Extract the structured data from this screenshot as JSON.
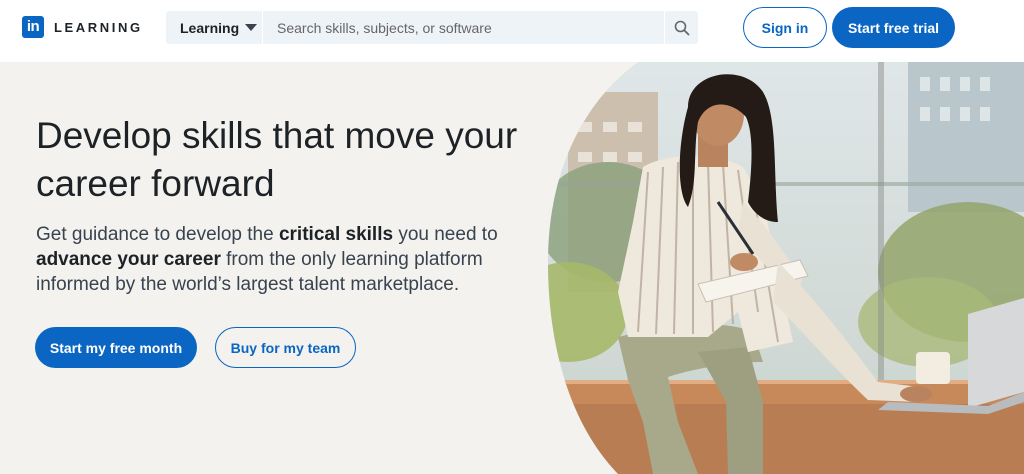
{
  "header": {
    "logo_mark": "in",
    "logo_word": "LEARNING",
    "search": {
      "category_label": "Learning",
      "placeholder": "Search skills, subjects, or software",
      "icon": "search-icon"
    },
    "signin_label": "Sign in",
    "trial_label": "Start free trial"
  },
  "hero": {
    "title": "Develop skills that move your career forward",
    "sub_part1": "Get guidance to develop the ",
    "sub_bold1": "critical skills",
    "sub_part2": " you need to ",
    "sub_bold2": "advance your career",
    "sub_part3": " from the only learning platform informed by the world’s largest talent marketplace.",
    "primary_cta": "Start my free month",
    "secondary_cta": "Buy for my team"
  },
  "colors": {
    "brand_blue": "#0a66c2",
    "hero_bg": "#f3f2ef",
    "search_bg": "#eef3f8"
  }
}
